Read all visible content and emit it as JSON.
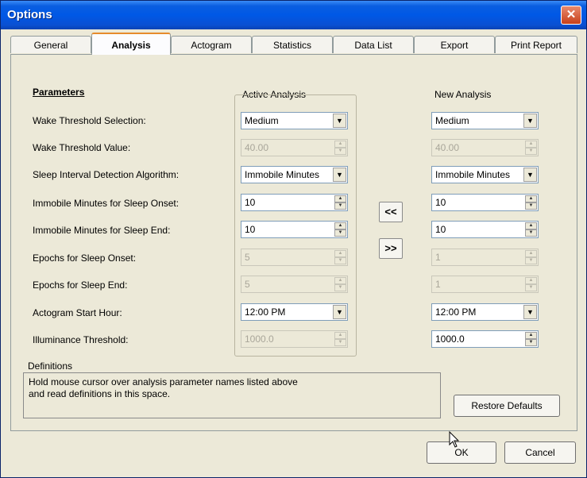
{
  "window": {
    "title": "Options",
    "close_symbol": "✕"
  },
  "tabs": [
    "General",
    "Analysis",
    "Actogram",
    "Statistics",
    "Data List",
    "Export",
    "Print Report"
  ],
  "parameters": {
    "heading": "Parameters",
    "labels": [
      "Wake Threshold Selection:",
      "Wake Threshold Value:",
      "Sleep Interval Detection Algorithm:",
      "Immobile Minutes for Sleep Onset:",
      "Immobile Minutes for Sleep End:",
      "Epochs for Sleep Onset:",
      "Epochs for Sleep End:",
      "Actogram Start Hour:",
      "Illuminance Threshold:"
    ]
  },
  "active": {
    "heading": "Active Analysis",
    "values": [
      "Medium",
      "40.00",
      "Immobile Minutes",
      "10",
      "10",
      "5",
      "5",
      "12:00 PM",
      "1000.0"
    ]
  },
  "new": {
    "heading": "New Analysis",
    "values": [
      "Medium",
      "40.00",
      "Immobile Minutes",
      "10",
      "10",
      "1",
      "1",
      "12:00 PM",
      "1000.0"
    ]
  },
  "copy_buttons": {
    "to_active": "<<",
    "to_new": ">>"
  },
  "definitions": {
    "label": "Definitions",
    "line1": "Hold mouse cursor over analysis parameter names listed above",
    "line2": "and read definitions in this space."
  },
  "buttons": {
    "restore_defaults": "Restore Defaults",
    "ok": "OK",
    "cancel": "Cancel"
  }
}
